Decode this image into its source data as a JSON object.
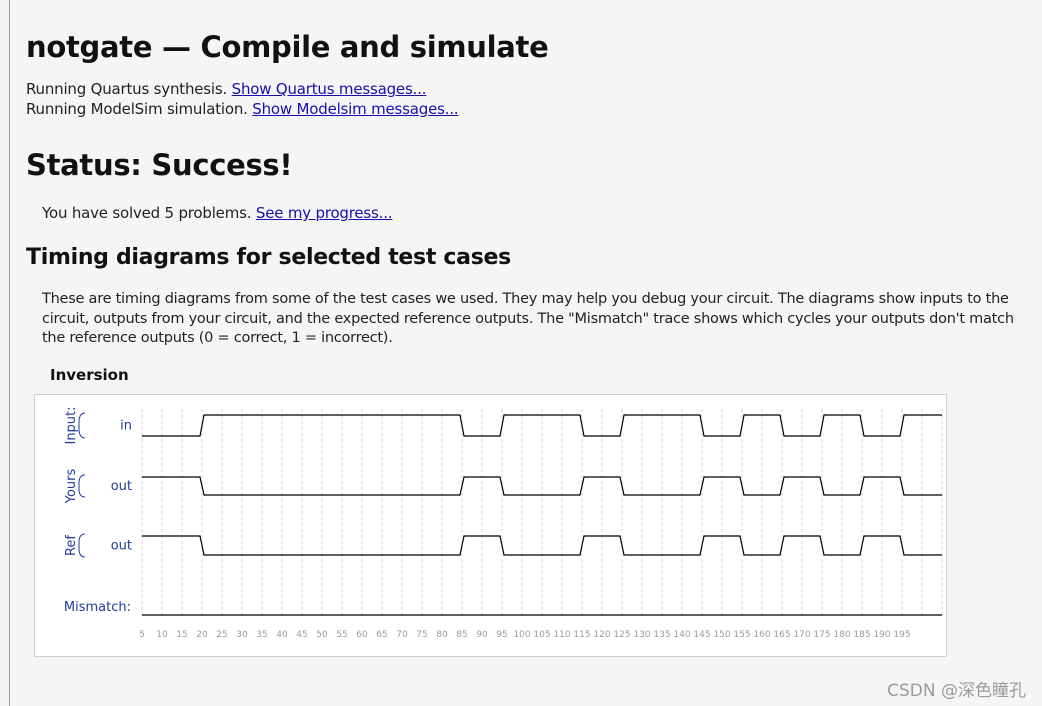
{
  "page": {
    "title": "notgate — Compile and simulate",
    "quartus_text": "Running Quartus synthesis.",
    "quartus_link": "Show Quartus messages...",
    "modelsim_text": "Running ModelSim simulation.",
    "modelsim_link": "Show Modelsim messages...",
    "status": "Status: Success!",
    "progress_text": "You have solved 5 problems.",
    "progress_link": "See my progress...",
    "timing_heading": "Timing diagrams for selected test cases",
    "description": "These are timing diagrams from some of the test cases we used. They may help you debug your circuit. The diagrams show inputs to the circuit, outputs from your circuit, and the expected reference outputs. The \"Mismatch\" trace shows which cycles your outputs don't match the reference outputs (0 = correct, 1 = incorrect).",
    "case_title": "Inversion"
  },
  "diagram": {
    "groups": [
      {
        "label": "Input:",
        "signal": "in",
        "values": [
          0,
          0,
          0,
          1,
          1,
          1,
          1,
          1,
          1,
          1,
          1,
          1,
          1,
          1,
          1,
          1,
          0,
          0,
          1,
          1,
          1,
          1,
          0,
          0,
          1,
          1,
          1,
          1,
          0,
          0,
          1,
          1,
          0,
          0,
          1,
          1,
          0,
          0,
          1,
          1
        ]
      },
      {
        "label": "Yours",
        "signal": "out",
        "values": [
          1,
          1,
          1,
          0,
          0,
          0,
          0,
          0,
          0,
          0,
          0,
          0,
          0,
          0,
          0,
          0,
          1,
          1,
          0,
          0,
          0,
          0,
          1,
          1,
          0,
          0,
          0,
          0,
          1,
          1,
          0,
          0,
          1,
          1,
          0,
          0,
          1,
          1,
          0,
          0
        ]
      },
      {
        "label": "Ref",
        "signal": "out",
        "values": [
          1,
          1,
          1,
          0,
          0,
          0,
          0,
          0,
          0,
          0,
          0,
          0,
          0,
          0,
          0,
          0,
          1,
          1,
          0,
          0,
          0,
          0,
          1,
          1,
          0,
          0,
          0,
          0,
          1,
          1,
          0,
          0,
          1,
          1,
          0,
          0,
          1,
          1,
          0,
          0
        ]
      }
    ],
    "mismatch_label": "Mismatch:",
    "mismatch_values": [
      0,
      0,
      0,
      0,
      0,
      0,
      0,
      0,
      0,
      0,
      0,
      0,
      0,
      0,
      0,
      0,
      0,
      0,
      0,
      0,
      0,
      0,
      0,
      0,
      0,
      0,
      0,
      0,
      0,
      0,
      0,
      0,
      0,
      0,
      0,
      0,
      0,
      0,
      0,
      0
    ],
    "time_ticks": [
      "5",
      "10",
      "15",
      "20",
      "25",
      "30",
      "35",
      "40",
      "45",
      "50",
      "55",
      "60",
      "65",
      "70",
      "75",
      "80",
      "85",
      "90",
      "95",
      "100",
      "105",
      "110",
      "115",
      "120",
      "125",
      "130",
      "135",
      "140",
      "145",
      "150",
      "155",
      "160",
      "165",
      "170",
      "175",
      "180",
      "185",
      "190",
      "195"
    ],
    "colors": {
      "label": "#1f3d99",
      "wave": "#000000",
      "tick": "#9a9a9a",
      "grid": "#d6d6d6"
    }
  },
  "watermark": "CSDN @深色瞳孔"
}
